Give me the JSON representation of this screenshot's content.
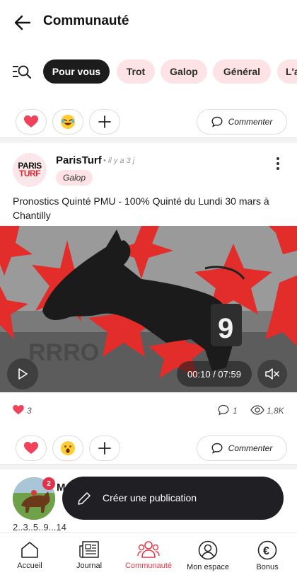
{
  "header": {
    "title": "Communauté"
  },
  "filters": {
    "chips": [
      {
        "label": "Pour vous",
        "active": true
      },
      {
        "label": "Trot",
        "active": false
      },
      {
        "label": "Galop",
        "active": false
      },
      {
        "label": "Général",
        "active": false
      },
      {
        "label": "L'a",
        "active": false
      }
    ]
  },
  "reactions_top": {
    "comment_label": "Commenter"
  },
  "post": {
    "logo_line1": "PARIS",
    "logo_line2": "TURF",
    "author": "ParisTurf",
    "time": "• il y a 3 j",
    "tag": "Galop",
    "text": "Pronostics Quinté PMU - 100% Quinté du Lundi 30 mars à Chantilly",
    "video_time": "00:10 / 07:59",
    "horse_number": "9",
    "likes": "3",
    "comments": "1",
    "views": "1,8K",
    "comment_label": "Commenter"
  },
  "post2": {
    "badge_count": "2",
    "name": "M",
    "text": "2..3..5..9...14"
  },
  "fab": {
    "label": "Créer une publication"
  },
  "bottom_nav": [
    {
      "label": "Accueil",
      "icon": "home-icon",
      "active": false
    },
    {
      "label": "Journal",
      "icon": "newspaper-icon",
      "active": false
    },
    {
      "label": "Communauté",
      "icon": "community-icon",
      "active": true
    },
    {
      "label": "Mon espace",
      "icon": "user-icon",
      "active": false
    },
    {
      "label": "Bonus",
      "icon": "euro-icon",
      "active": false
    }
  ],
  "colors": {
    "accent": "#e23a4a",
    "chip_bg": "#fde3e6",
    "dark": "#1c1c1c"
  }
}
